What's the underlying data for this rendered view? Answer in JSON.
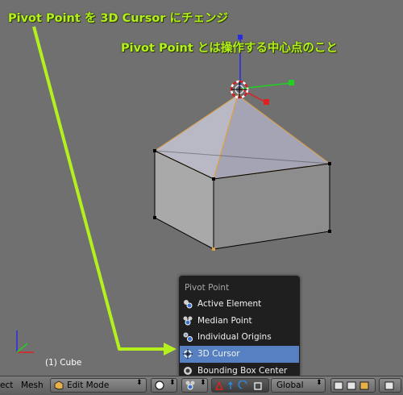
{
  "annotations": {
    "line1": "Pivot Point を 3D Cursor にチェンジ",
    "line2": "Pivot Point とは操作する中心点のこと"
  },
  "viewport": {
    "object_info": "(1) Cube"
  },
  "pivot_menu": {
    "title": "Pivot Point",
    "items": [
      {
        "label": "Active Element",
        "icon": "active-element-icon"
      },
      {
        "label": "Median Point",
        "icon": "median-point-icon"
      },
      {
        "label": "Individual Origins",
        "icon": "individual-origins-icon"
      },
      {
        "label": "3D Cursor",
        "icon": "3d-cursor-icon",
        "selected": true
      },
      {
        "label": "Bounding Box Center",
        "icon": "bounding-box-center-icon"
      }
    ]
  },
  "header": {
    "menu_select": "ect",
    "menu_mesh": "Mesh",
    "mode": "Edit Mode",
    "orientation": "Global"
  },
  "colors": {
    "annotation": "#b4f01e",
    "menu_highlight": "#5680c2",
    "menu_bg": "#1f1f1f",
    "viewport_bg": "#707070"
  }
}
